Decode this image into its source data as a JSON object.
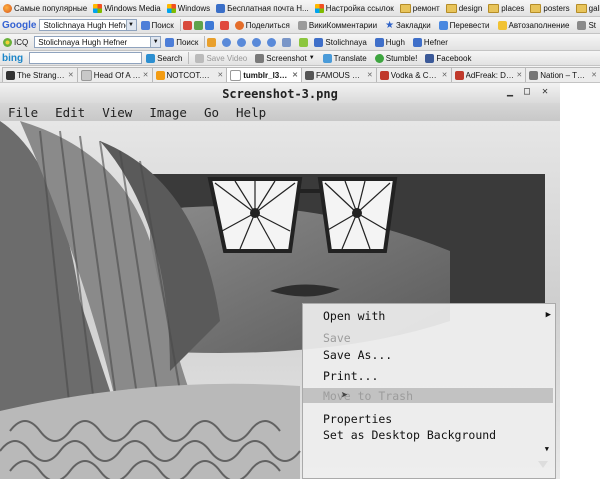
{
  "bookmarks": [
    {
      "label": "Самые популярные",
      "icon": "firefox-icon"
    },
    {
      "label": "Windows Media",
      "icon": "windows-icon"
    },
    {
      "label": "Windows",
      "icon": "windows-icon"
    },
    {
      "label": "Бесплатная почта H...",
      "icon": "mail-icon"
    },
    {
      "label": "Настройка ссылок",
      "icon": "windows-icon"
    },
    {
      "label": "ремонт",
      "icon": "folder-icon"
    },
    {
      "label": "design",
      "icon": "folder-icon"
    },
    {
      "label": "places",
      "icon": "folder-icon"
    },
    {
      "label": "posters",
      "icon": "folder-icon"
    },
    {
      "label": "gallery",
      "icon": "folder-icon"
    }
  ],
  "google_toolbar": {
    "logo": "Google",
    "query": "Stolichnaya Hugh Hefner",
    "search_label": "Поиск",
    "share_label": "Поделиться",
    "comments_label": "ВикиКомментарии",
    "bookmarks_label": "Закладки",
    "translate_label": "Перевести",
    "autofill_label": "Автозаполнение",
    "settings_label": "St"
  },
  "icq_toolbar": {
    "logo": "ICQ",
    "query": "Stolichnaya Hugh Hefner",
    "search_label": "Поиск",
    "highlights": [
      "Stolichnaya",
      "Hugh",
      "Hefner"
    ]
  },
  "bing_toolbar": {
    "logo": "bing",
    "query": "",
    "search_label": "Search",
    "save_label": "Save Video",
    "screenshot_label": "Screenshot",
    "translate_label": "Translate",
    "stumble_label": "Stumble!",
    "facebook_label": "Facebook"
  },
  "tabs": [
    {
      "label": "The Strange Attrac...",
      "active": false
    },
    {
      "label": "Head Of A Wolf",
      "active": false
    },
    {
      "label": "NOTCOT.ORG",
      "active": false
    },
    {
      "label": "tumblr_l3aj...",
      "active": true
    },
    {
      "label": "FAMOUS WHEN DE...",
      "active": false
    },
    {
      "label": "Vodka & Co. | Abso...",
      "active": false
    },
    {
      "label": "AdFreak: Double y...",
      "active": false
    },
    {
      "label": "Nation – The Face...",
      "active": false
    }
  ],
  "viewer": {
    "title": "Screenshot-3.png",
    "menu": [
      "File",
      "Edit",
      "View",
      "Image",
      "Go",
      "Help"
    ],
    "context_menu": [
      {
        "label": "Open with",
        "enabled": true,
        "submenu": true
      },
      {
        "label": "Save",
        "enabled": false
      },
      {
        "label": "Save As...",
        "enabled": true
      },
      {
        "label": "Print...",
        "enabled": true
      },
      {
        "label": "Move to Trash",
        "enabled": false,
        "highlighted": true
      },
      {
        "label": "Properties",
        "enabled": true
      },
      {
        "label": "Set as Desktop Background",
        "enabled": true
      }
    ]
  }
}
